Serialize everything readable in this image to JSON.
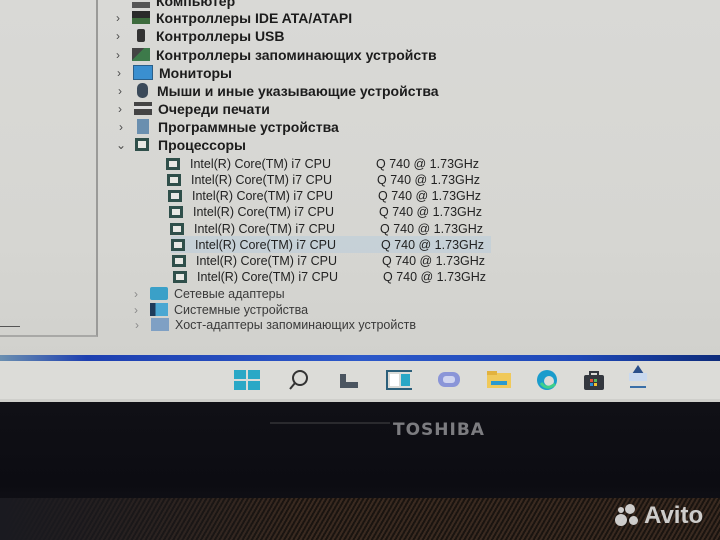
{
  "device_manager": {
    "top_partial_label": "Компьютер",
    "categories": [
      {
        "label": "Контроллеры IDE ATA/ATAPI",
        "icon": "ide-controller-icon",
        "expanded": false
      },
      {
        "label": "Контроллеры USB",
        "icon": "usb-icon",
        "expanded": false
      },
      {
        "label": "Контроллеры запоминающих устройств",
        "icon": "storage-controller-icon",
        "expanded": false
      },
      {
        "label": "Мониторы",
        "icon": "monitor-icon",
        "expanded": false
      },
      {
        "label": "Мыши и иные указывающие устройства",
        "icon": "mouse-icon",
        "expanded": false
      },
      {
        "label": "Очереди печати",
        "icon": "printer-icon",
        "expanded": false
      },
      {
        "label": "Программные устройства",
        "icon": "software-device-icon",
        "expanded": false
      },
      {
        "label": "Процессоры",
        "icon": "processor-icon",
        "expanded": true
      }
    ],
    "processors": [
      {
        "name": "Intel(R) Core(TM) i7 CPU",
        "model": "Q 740  @ 1.73GHz"
      },
      {
        "name": "Intel(R) Core(TM) i7 CPU",
        "model": "Q 740  @ 1.73GHz"
      },
      {
        "name": "Intel(R) Core(TM) i7 CPU",
        "model": "Q 740  @ 1.73GHz"
      },
      {
        "name": "Intel(R) Core(TM) i7 CPU",
        "model": "Q 740  @ 1.73GHz"
      },
      {
        "name": "Intel(R) Core(TM) i7 CPU",
        "model": "Q 740  @ 1.73GHz"
      },
      {
        "name": "Intel(R) Core(TM) i7 CPU",
        "model": "Q 740  @ 1.73GHz",
        "selected": true
      },
      {
        "name": "Intel(R) Core(TM) i7 CPU",
        "model": "Q 740  @ 1.73GHz"
      },
      {
        "name": "Intel(R) Core(TM) i7 CPU",
        "model": "Q 740  @ 1.73GHz"
      }
    ],
    "after_categories": [
      {
        "label": "Сетевые адаптеры",
        "icon": "network-adapter-icon"
      },
      {
        "label": "Системные устройства",
        "icon": "system-devices-icon"
      },
      {
        "label": "Хост-адаптеры запоминающих устройств",
        "icon": "storage-host-adapter-icon"
      }
    ]
  },
  "taskbar": {
    "icons": [
      "start-icon",
      "search-icon",
      "task-view-icon",
      "widgets-icon",
      "chat-icon",
      "file-explorer-icon",
      "edge-icon",
      "store-icon",
      "control-panel-icon"
    ]
  },
  "laptop": {
    "brand": "TOSHIBA"
  },
  "watermark": {
    "text": "Avito"
  }
}
